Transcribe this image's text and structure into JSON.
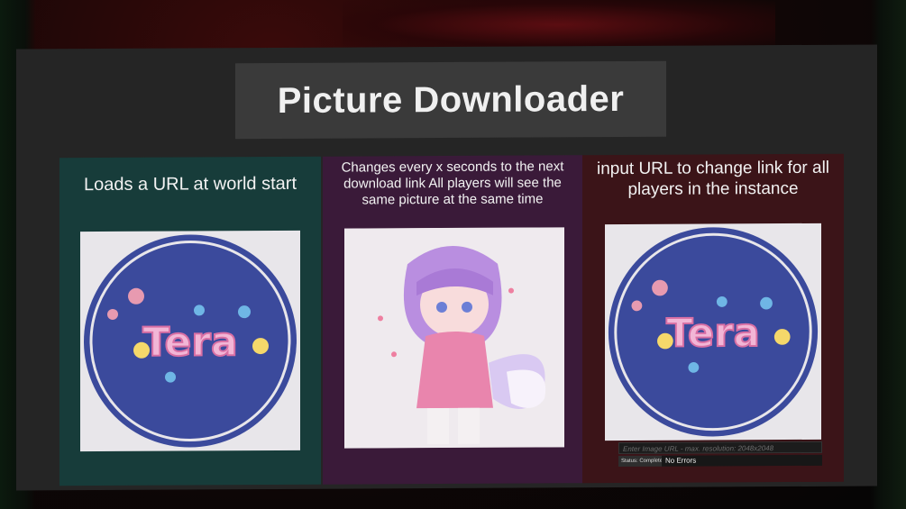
{
  "title": "Picture Downloader",
  "panels": [
    {
      "text": "Loads a URL at world start",
      "image": "tera-logo"
    },
    {
      "text": "Changes every x seconds to the next download link All players will see the same picture at the same time",
      "image": "anime-character-art"
    },
    {
      "text": "input URL to change link for all players in the instance",
      "image": "tera-logo"
    }
  ],
  "logo_text": "Tera",
  "url_input": {
    "placeholder": "Enter Image URL - max. resolution: 2048x2048"
  },
  "status": {
    "label": "Status: Complete",
    "value": "No Errors"
  },
  "colors": {
    "board": "#252525",
    "panel_teal": "#173c3a",
    "panel_purple": "#3a1a39",
    "panel_red": "#3b1418",
    "logo_blue": "#3b4a9c"
  }
}
